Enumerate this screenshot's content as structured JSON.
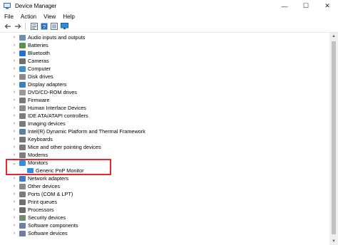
{
  "window": {
    "title": "Device Manager",
    "minimize": "—",
    "maximize": "☐",
    "close": "✕"
  },
  "menu": [
    "File",
    "Action",
    "View",
    "Help"
  ],
  "toolbar": [
    "back-icon",
    "forward-icon",
    "properties-icon",
    "help-icon",
    "show-hidden-icon",
    "monitor-icon"
  ],
  "tree": [
    {
      "label": "Audio inputs and outputs",
      "icon": "speaker-icon",
      "color": "#6c8fb3"
    },
    {
      "label": "Batteries",
      "icon": "battery-icon",
      "color": "#5f8f4f"
    },
    {
      "label": "Bluetooth",
      "icon": "bluetooth-icon",
      "color": "#1e6fd9"
    },
    {
      "label": "Cameras",
      "icon": "camera-icon",
      "color": "#6f6f6f"
    },
    {
      "label": "Computer",
      "icon": "computer-icon",
      "color": "#3c8fd6"
    },
    {
      "label": "Disk drives",
      "icon": "disk-icon",
      "color": "#8a8a8a"
    },
    {
      "label": "Display adapters",
      "icon": "display-adapter-icon",
      "color": "#3d7fbf"
    },
    {
      "label": "DVD/CD-ROM drives",
      "icon": "dvd-icon",
      "color": "#9a9a9a"
    },
    {
      "label": "Firmware",
      "icon": "firmware-icon",
      "color": "#7a7a7a"
    },
    {
      "label": "Human Interface Devices",
      "icon": "hid-icon",
      "color": "#8c8c8c"
    },
    {
      "label": "IDE ATA/ATAPI controllers",
      "icon": "ide-icon",
      "color": "#7d7d7d"
    },
    {
      "label": "Imaging devices",
      "icon": "imaging-icon",
      "color": "#7b7b7b"
    },
    {
      "label": "Intel(R) Dynamic Platform and Thermal Framework",
      "icon": "chip-icon",
      "color": "#5b7fa8"
    },
    {
      "label": "Keyboards",
      "icon": "keyboard-icon",
      "color": "#777777"
    },
    {
      "label": "Mice and other pointing devices",
      "icon": "mouse-icon",
      "color": "#7a7a7a"
    },
    {
      "label": "Modems",
      "icon": "modem-icon",
      "color": "#7e7e7e"
    },
    {
      "label": "Monitors",
      "icon": "monitor-icon",
      "color": "#2f8ee0",
      "expanded": true
    },
    {
      "label": "Generic PnP Monitor",
      "icon": "monitor-icon",
      "color": "#2f8ee0",
      "child": true
    },
    {
      "label": "Network adapters",
      "icon": "network-icon",
      "color": "#3b7ec4"
    },
    {
      "label": "Other devices",
      "icon": "unknown-device-icon",
      "color": "#8a8a8a"
    },
    {
      "label": "Ports (COM & LPT)",
      "icon": "port-icon",
      "color": "#7b7b7b"
    },
    {
      "label": "Print queues",
      "icon": "printer-icon",
      "color": "#6f6f6f"
    },
    {
      "label": "Processors",
      "icon": "processor-icon",
      "color": "#6a6a6a"
    },
    {
      "label": "Security devices",
      "icon": "security-icon",
      "color": "#6f8f6f"
    },
    {
      "label": "Software components",
      "icon": "component-icon",
      "color": "#6f7fa0"
    },
    {
      "label": "Software devices",
      "icon": "software-device-icon",
      "color": "#6f7fa0"
    }
  ]
}
